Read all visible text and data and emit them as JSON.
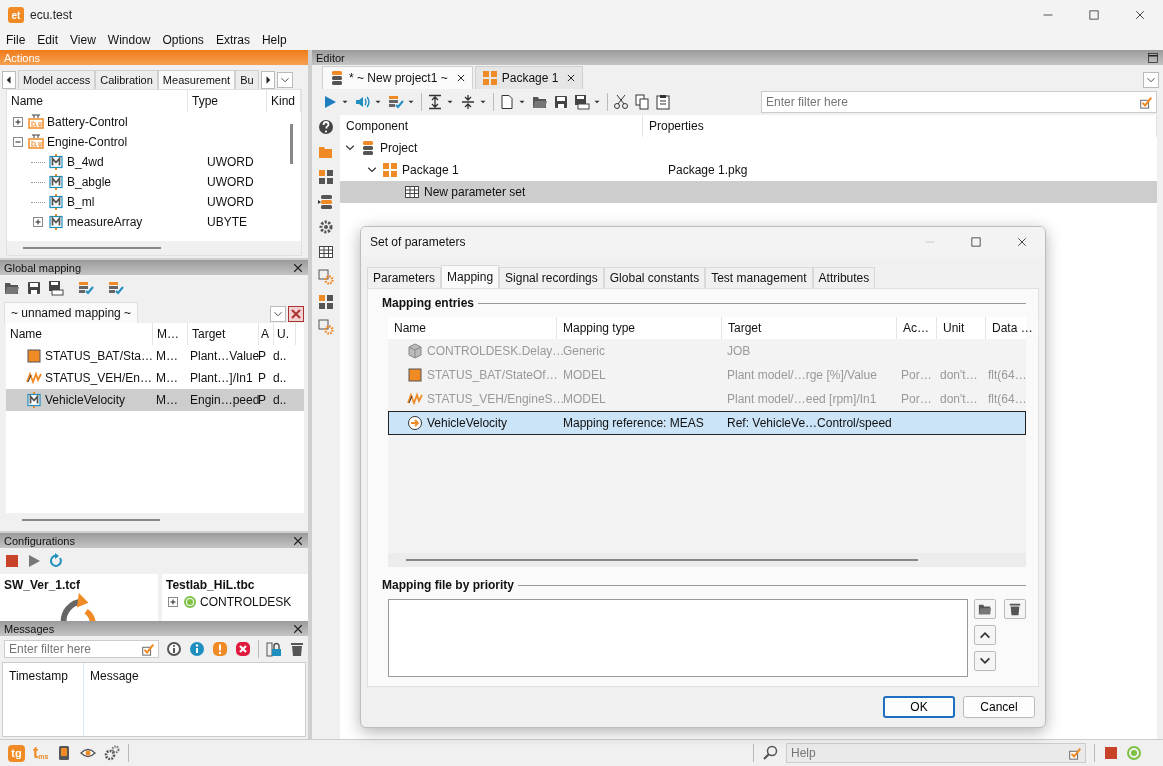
{
  "app": {
    "logo": "et",
    "title": "ecu.test"
  },
  "menu": [
    "File",
    "Edit",
    "View",
    "Window",
    "Options",
    "Extras",
    "Help"
  ],
  "actions": {
    "title": "Actions",
    "tabs": [
      {
        "label": "Model access",
        "selected": false
      },
      {
        "label": "Calibration",
        "selected": false
      },
      {
        "label": "Measurement",
        "selected": true
      },
      {
        "label": "Bu",
        "selected": false
      }
    ],
    "columns": [
      "Name",
      "Type",
      "Kind"
    ],
    "tree": [
      {
        "name": "Battery-Control",
        "kind": "ecu",
        "expanded": false
      },
      {
        "name": "Engine-Control",
        "kind": "ecu",
        "expanded": true,
        "children": [
          {
            "name": "B_4wd",
            "type": "UWORD",
            "kind": "meas"
          },
          {
            "name": "B_abgle",
            "type": "UWORD",
            "kind": "meas"
          },
          {
            "name": "B_ml",
            "type": "UWORD",
            "kind": "meas"
          },
          {
            "name": "measureArray",
            "type": "UBYTE",
            "kind": "meas",
            "expanded": false
          }
        ]
      }
    ]
  },
  "global_mapping": {
    "title": "Global mapping",
    "tab": "~ unnamed mapping ~",
    "columns": [
      "Name",
      "M…",
      "Target",
      "A",
      "U."
    ],
    "rows": [
      {
        "kind": "model",
        "cells": [
          "STATUS_BAT/Sta…",
          "M…",
          "Plant…Value",
          "P",
          "d.."
        ],
        "selected": false
      },
      {
        "kind": "signal",
        "cells": [
          "STATUS_VEH/En…",
          "M…",
          "Plant…]/In1",
          "P",
          "d.."
        ],
        "selected": false
      },
      {
        "kind": "meas",
        "cells": [
          "VehicleVelocity",
          "M…",
          "Engin…peed",
          "P",
          "d.."
        ],
        "selected": true
      }
    ]
  },
  "configurations": {
    "title": "Configurations",
    "test_config": "SW_Ver_1.tcf",
    "test_bench": "Testlab_HiL.tbc",
    "tools": [
      {
        "name": "CONTROLDESK",
        "color": "#7dc242",
        "expanded": false
      }
    ]
  },
  "messages": {
    "title": "Messages",
    "filter_placeholder": "Enter filter here",
    "columns": [
      "Timestamp",
      "Message"
    ]
  },
  "footer": {
    "apps": [
      {
        "kind": "tg",
        "label": "tg"
      },
      {
        "kind": "tms",
        "label": "t",
        "sub": "ms"
      }
    ],
    "help_placeholder": "Help"
  },
  "editor": {
    "title": "Editor",
    "tabs": [
      {
        "label": "* ~ New project1 ~",
        "kind": "project",
        "selected": true
      },
      {
        "label": "Package 1",
        "kind": "package",
        "selected": false
      }
    ],
    "filter_placeholder": "Enter filter here",
    "columns": [
      "Component",
      "Properties"
    ],
    "tree": [
      {
        "name": "Project",
        "kind": "project",
        "expanded": true,
        "children": [
          {
            "name": "Package 1",
            "kind": "package",
            "property": "Package 1.pkg",
            "expanded": true,
            "children": [
              {
                "name": "New parameter set",
                "kind": "table",
                "selected": true
              }
            ]
          }
        ]
      }
    ]
  },
  "dialog": {
    "title": "Set of parameters",
    "tabs": [
      {
        "label": "Parameters",
        "selected": false
      },
      {
        "label": "Mapping",
        "selected": true
      },
      {
        "label": "Signal recordings",
        "selected": false
      },
      {
        "label": "Global constants",
        "selected": false
      },
      {
        "label": "Test management",
        "selected": false
      },
      {
        "label": "Attributes",
        "selected": false
      }
    ],
    "entries_title": "Mapping entries",
    "columns": [
      "Name",
      "Mapping type",
      "Target",
      "Ac…",
      "Unit",
      "Data …"
    ],
    "rows": [
      {
        "kind": "generic",
        "cells": [
          "CONTROLDESK.Delay…",
          "Generic",
          "JOB",
          "",
          "",
          ""
        ],
        "disabled": true,
        "selected": false
      },
      {
        "kind": "model",
        "cells": [
          "STATUS_BAT/StateOf…",
          "MODEL",
          "Plant model/…rge [%]/Value",
          "Por…",
          "don't…",
          "flt(64…"
        ],
        "disabled": true,
        "selected": false
      },
      {
        "kind": "signal",
        "cells": [
          "STATUS_VEH/EngineS…",
          "MODEL",
          "Plant model/…eed [rpm]/In1",
          "Por…",
          "don't…",
          "flt(64…"
        ],
        "disabled": true,
        "selected": false
      },
      {
        "kind": "reference",
        "cells": [
          "VehicleVelocity",
          "Mapping reference: MEAS",
          "Ref: VehicleVe…Control/speed",
          "",
          "",
          ""
        ],
        "disabled": false,
        "selected": true
      }
    ],
    "files_title": "Mapping file by priority",
    "buttons": [
      {
        "label": "OK",
        "default": true
      },
      {
        "label": "Cancel",
        "default": false
      }
    ]
  }
}
